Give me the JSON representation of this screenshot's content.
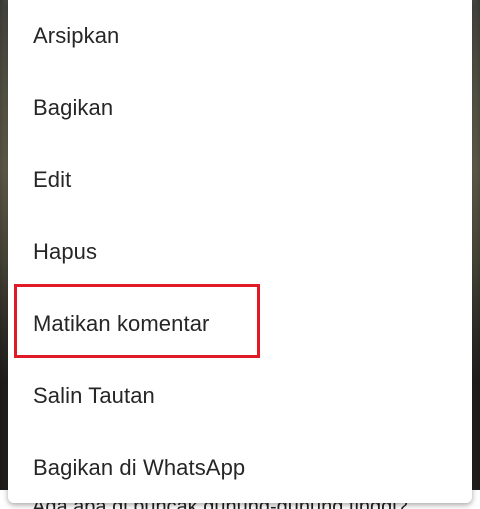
{
  "menu": {
    "items": [
      {
        "label": "Arsipkan"
      },
      {
        "label": "Bagikan"
      },
      {
        "label": "Edit"
      },
      {
        "label": "Hapus"
      },
      {
        "label": "Matikan komentar"
      },
      {
        "label": "Salin Tautan"
      },
      {
        "label": "Bagikan di WhatsApp"
      }
    ],
    "highlighted_item": "Matikan komentar",
    "highlight_color": "#e01a26"
  },
  "background": {
    "caption": "Ada apa di puncak gunung-gunung tinggi?"
  }
}
